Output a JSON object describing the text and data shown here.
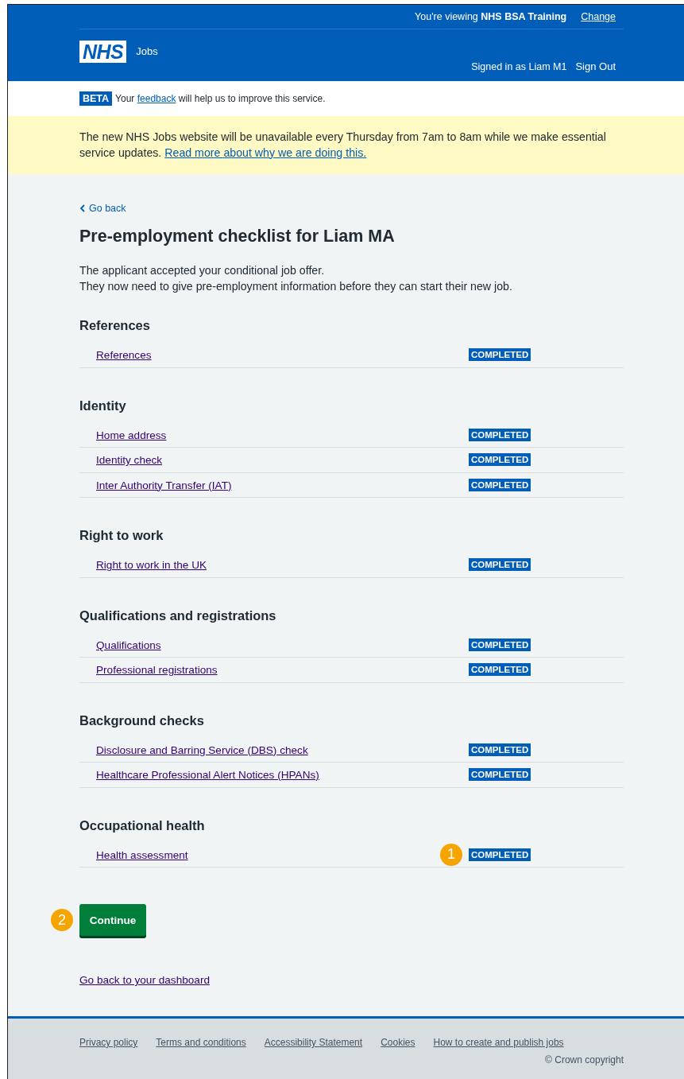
{
  "header": {
    "viewing_prefix": "You're viewing",
    "organisation": "NHS BSA Training",
    "change_link": "Change",
    "logo": "NHS",
    "service_name": "Jobs",
    "signed_in": "Signed in as Liam M1",
    "sign_out": "Sign Out"
  },
  "phase_banner": {
    "tag": "BETA",
    "text_before": "Your",
    "link": "feedback",
    "text_after": "will help us to improve this service."
  },
  "notice": {
    "text": "The new NHS Jobs website will be unavailable every Thursday from 7am to 8am while we make essential service updates.",
    "link": "Read more about why we are doing this."
  },
  "back_link": "Go back",
  "title": "Pre-employment checklist for Liam MA",
  "intro": [
    "The applicant accepted your conditional job offer.",
    "They now need to give pre-employment information before they can start their new job."
  ],
  "sections": [
    {
      "heading": "References",
      "items": [
        {
          "label": "References",
          "status": "COMPLETED"
        }
      ]
    },
    {
      "heading": "Identity",
      "items": [
        {
          "label": "Home address",
          "status": "COMPLETED"
        },
        {
          "label": "Identity check",
          "status": "COMPLETED"
        },
        {
          "label": "Inter Authority Transfer (IAT)",
          "status": "COMPLETED"
        }
      ]
    },
    {
      "heading": "Right to work",
      "items": [
        {
          "label": "Right to work in the UK",
          "status": "COMPLETED"
        }
      ]
    },
    {
      "heading": "Qualifications and registrations",
      "items": [
        {
          "label": "Qualifications",
          "status": "COMPLETED"
        },
        {
          "label": "Professional registrations",
          "status": "COMPLETED"
        }
      ]
    },
    {
      "heading": "Background checks",
      "items": [
        {
          "label": "Disclosure and Barring Service (DBS) check",
          "status": "COMPLETED"
        },
        {
          "label": "Healthcare Professional Alert Notices (HPANs)",
          "status": "COMPLETED"
        }
      ]
    },
    {
      "heading": "Occupational health",
      "items": [
        {
          "label": "Health assessment",
          "status": "COMPLETED",
          "callout": "1"
        }
      ]
    }
  ],
  "continue_button": {
    "label": "Continue",
    "callout": "2"
  },
  "dashboard_link": "Go back to your dashboard",
  "footer": {
    "links": [
      "Privacy policy",
      "Terms and conditions",
      "Accessibility Statement",
      "Cookies",
      "How to create and publish jobs"
    ],
    "copyright": "© Crown copyright"
  }
}
